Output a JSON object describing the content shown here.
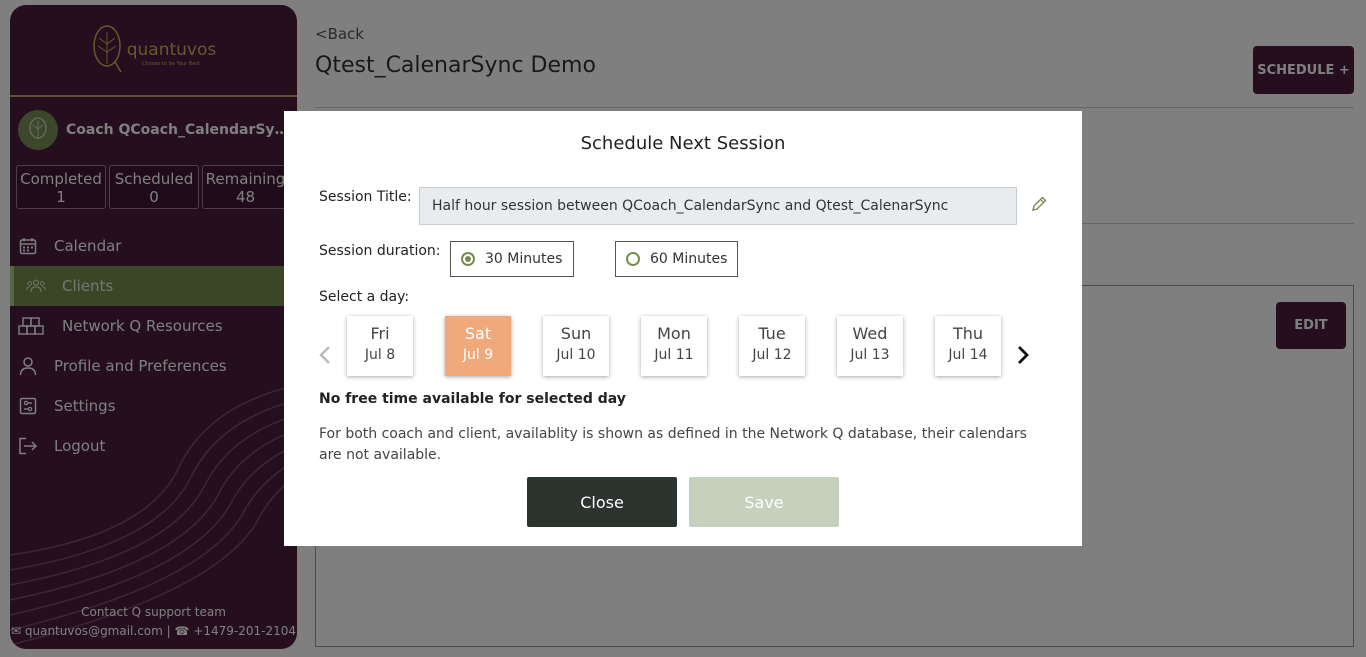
{
  "sidebar": {
    "brand": "quantuvos",
    "tagline": "Choose to be Your Best",
    "coach_name": "Coach QCoach_CalendarSync'...",
    "stats": [
      {
        "label": "Completed",
        "value": "1"
      },
      {
        "label": "Scheduled",
        "value": "0"
      },
      {
        "label": "Remaining",
        "value": "48"
      }
    ],
    "nav": [
      {
        "label": "Calendar",
        "icon": "calendar-icon"
      },
      {
        "label": "Clients",
        "icon": "users-icon",
        "active": true
      },
      {
        "label": "Network Q Resources",
        "icon": "boxes-icon"
      },
      {
        "label": "Profile and Preferences",
        "icon": "person-icon"
      },
      {
        "label": "Settings",
        "icon": "settings-icon"
      },
      {
        "label": "Logout",
        "icon": "logout-icon"
      }
    ],
    "support_title": "Contact Q support team",
    "support_email": "quantuvos@gmail.com",
    "support_phone": "+1479-201-2104",
    "accent": "#4a1d3d",
    "active_color": "#778c4e"
  },
  "main": {
    "back": "<Back",
    "title": "Qtest_CalenarSync Demo",
    "schedule_label": "SCHEDULE +",
    "edit_label": "EDIT"
  },
  "modal": {
    "title": "Schedule Next Session",
    "session_title_label": "Session Title:",
    "session_title_value": "Half hour session between QCoach_CalendarSync and Qtest_CalenarSync",
    "duration_label": "Session duration:",
    "durations": [
      {
        "label": "30 Minutes",
        "selected": true
      },
      {
        "label": "60 Minutes",
        "selected": false
      }
    ],
    "select_day_label": "Select a day:",
    "days": [
      {
        "name": "Fri",
        "date": "Jul 8"
      },
      {
        "name": "Sat",
        "date": "Jul 9",
        "selected": true
      },
      {
        "name": "Sun",
        "date": "Jul 10"
      },
      {
        "name": "Mon",
        "date": "Jul 11"
      },
      {
        "name": "Tue",
        "date": "Jul 12"
      },
      {
        "name": "Wed",
        "date": "Jul 13"
      },
      {
        "name": "Thu",
        "date": "Jul 14"
      }
    ],
    "no_time_msg": "No free time available for selected day",
    "info_msg": "For both coach and client, availablity is shown as defined in the Network Q database, their calendars are not available.",
    "close_label": "Close",
    "save_label": "Save",
    "selected_day_color": "#f0a97a"
  }
}
